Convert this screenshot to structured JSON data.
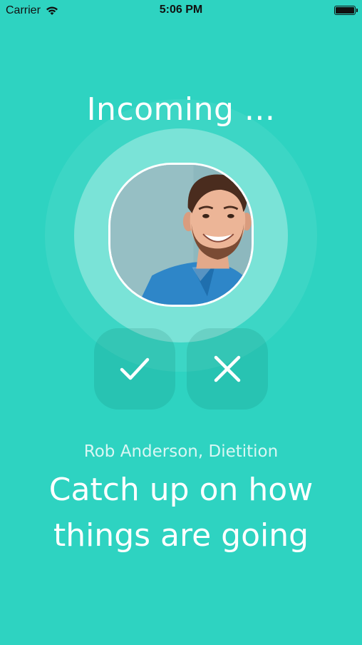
{
  "status_bar": {
    "carrier": "Carrier",
    "wifi_icon": "wifi-icon",
    "time": "5:06 PM",
    "battery_icon": "battery-full-icon"
  },
  "call": {
    "title": "Incoming ...",
    "avatar_icon": "caller-photo",
    "accept_icon": "checkmark-icon",
    "decline_icon": "close-icon",
    "caller_name": "Rob Anderson, Dietition",
    "message_line1": "Catch up on how",
    "message_line2": "things are going"
  },
  "colors": {
    "background": "#2ED3C1",
    "text": "#FFFFFF"
  }
}
